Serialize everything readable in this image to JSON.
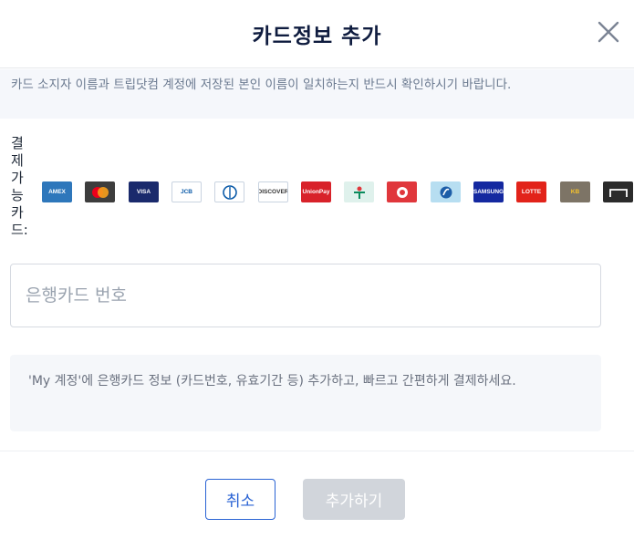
{
  "header": {
    "title": "카드정보 추가",
    "close_icon": "close-icon"
  },
  "notice": {
    "text": "카드 소지자 이름과 트립닷컴 계정에 저장된 본인 이름이 일치하는지 반드시 확인하시기 바랍니다."
  },
  "cards": {
    "label": "결제가능카드:",
    "items": [
      {
        "name": "amex",
        "text": "AMEX",
        "bg": "#2e77bb",
        "fg": "#ffffff"
      },
      {
        "name": "mastercard",
        "text": "",
        "bg": "#3d3d3d",
        "fg": "#ffffff"
      },
      {
        "name": "visa",
        "text": "VISA",
        "bg": "#1a2a6c",
        "fg": "#ffffff"
      },
      {
        "name": "jcb",
        "text": "JCB",
        "bg": "#ffffff",
        "fg": "#0a5aa8"
      },
      {
        "name": "diners",
        "text": "",
        "bg": "#ffffff",
        "fg": "#0a5aa8"
      },
      {
        "name": "discover",
        "text": "DISCOVER",
        "bg": "#ffffff",
        "fg": "#333333"
      },
      {
        "name": "unionpay",
        "text": "UnionPay",
        "bg": "#d8222a",
        "fg": "#ffffff"
      },
      {
        "name": "kb-card",
        "text": "",
        "bg": "#dff1ec",
        "fg": "#0a8a5c"
      },
      {
        "name": "bc-card",
        "text": "",
        "bg": "#e0373c",
        "fg": "#ffffff"
      },
      {
        "name": "shinhan",
        "text": "",
        "bg": "#b7def1",
        "fg": "#1d5ea8"
      },
      {
        "name": "samsung",
        "text": "SAMSUNG",
        "bg": "#1428a0",
        "fg": "#ffffff"
      },
      {
        "name": "lotte",
        "text": "LOTTE",
        "bg": "#e2231a",
        "fg": "#ffffff"
      },
      {
        "name": "kb-kookmin",
        "text": "KB",
        "bg": "#7d7466",
        "fg": "#f5c22d"
      },
      {
        "name": "hyundai",
        "text": "",
        "bg": "#2b2b2b",
        "fg": "#ffffff"
      }
    ]
  },
  "card_input": {
    "placeholder": "은행카드 번호",
    "value": ""
  },
  "info": {
    "text": "'My 계정'에 은행카드 정보 (카드번호, 유효기간 등) 추가하고, 빠르고 간편하게 결제하세요."
  },
  "footer": {
    "cancel_label": "취소",
    "add_label": "추가하기",
    "add_disabled_color": "#d1d5db",
    "accent_color": "#2a63d4"
  }
}
